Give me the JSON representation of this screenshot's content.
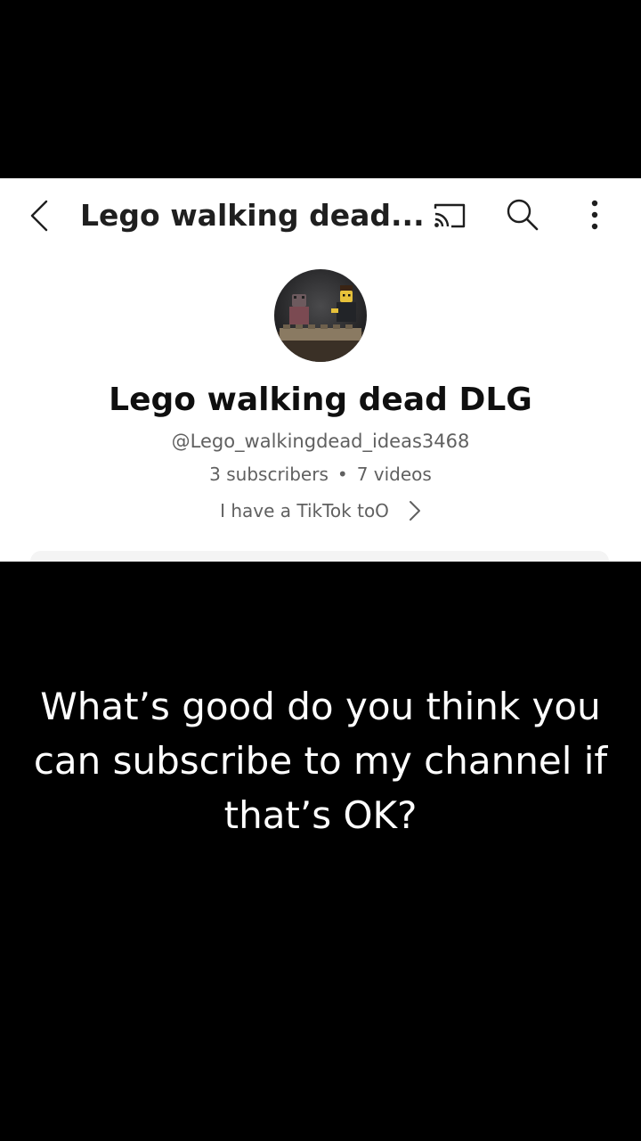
{
  "header": {
    "title": "Lego walking dead...",
    "icons": {
      "back": "chevron-left-icon",
      "cast": "cast-icon",
      "search": "search-icon",
      "more": "more-vertical-icon"
    }
  },
  "channel": {
    "name": "Lego walking dead DLG",
    "handle": "@Lego_walkingdead_ideas3468",
    "subscribers": "3 subscribers",
    "separator": "•",
    "videos": "7 videos",
    "description": "I have a TikTok toO"
  },
  "caption": {
    "text": "What’s good do you think you can subscribe to my channel if that’s OK?"
  },
  "colors": {
    "background": "#000000",
    "card": "#ffffff",
    "title_text": "#0f0f0f",
    "secondary_text": "#606060",
    "caption_text": "#ffffff"
  }
}
